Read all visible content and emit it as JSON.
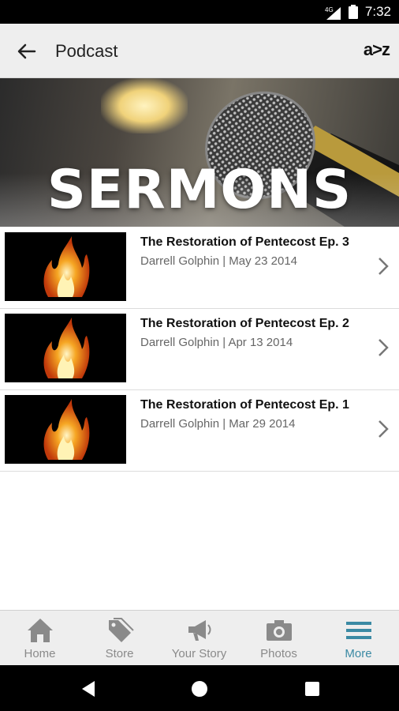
{
  "status_bar": {
    "network": "4G",
    "time": "7:32"
  },
  "app_bar": {
    "title": "Podcast",
    "sort_label": "a>z"
  },
  "banner": {
    "title": "SERMONS"
  },
  "episodes": [
    {
      "title": "The Restoration of Pentecost Ep. 3",
      "meta": "Darrell Golphin | May 23 2014"
    },
    {
      "title": "The Restoration of Pentecost Ep. 2",
      "meta": "Darrell Golphin | Apr 13 2014"
    },
    {
      "title": "The Restoration of Pentecost Ep. 1",
      "meta": "Darrell Golphin | Mar 29 2014"
    }
  ],
  "bottom_nav": {
    "items": [
      {
        "label": "Home",
        "icon": "home-icon"
      },
      {
        "label": "Store",
        "icon": "tag-icon"
      },
      {
        "label": "Your Story",
        "icon": "megaphone-icon"
      },
      {
        "label": "Photos",
        "icon": "camera-icon"
      },
      {
        "label": "More",
        "icon": "menu-icon"
      }
    ],
    "active": "More"
  },
  "colors": {
    "accent": "#3b8aa4",
    "inactive": "#8a8a8a"
  }
}
